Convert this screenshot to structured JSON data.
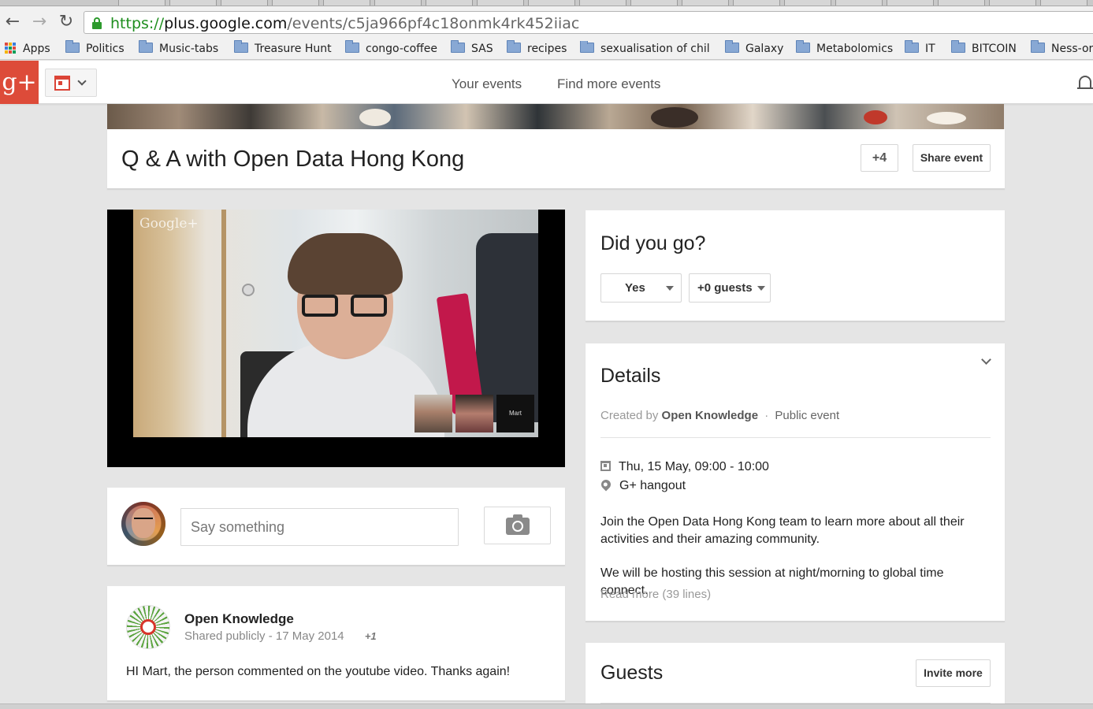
{
  "browser": {
    "url_scheme": "https://",
    "url_domain": "plus.google.com",
    "url_path": "/events/c5ja966pf4c18onmk4rk452iiac",
    "bookmarks": [
      {
        "label": "Apps"
      },
      {
        "label": "Politics"
      },
      {
        "label": "Music-tabs"
      },
      {
        "label": "Treasure Hunt"
      },
      {
        "label": "congo-coffee"
      },
      {
        "label": "SAS"
      },
      {
        "label": "recipes"
      },
      {
        "label": "sexualisation of chil"
      },
      {
        "label": "Galaxy"
      },
      {
        "label": "Metabolomics"
      },
      {
        "label": "IT"
      },
      {
        "label": "BITCOIN"
      },
      {
        "label": "Ness-or"
      }
    ]
  },
  "header": {
    "logo_text": "g+",
    "nav": [
      {
        "label": "Your events"
      },
      {
        "label": "Find more events"
      }
    ]
  },
  "event": {
    "title": "Q & A with Open Data Hong Kong",
    "plus_count": "+4",
    "share_label": "Share event"
  },
  "video": {
    "watermark": "Google+",
    "thumb_label": "Mart"
  },
  "comment": {
    "placeholder": "Say something"
  },
  "post": {
    "author": "Open Knowledge",
    "visibility": "Shared publicly",
    "separator": "-",
    "date": "17 May 2014",
    "plusone": "+1",
    "body": "HI Mart, the person commented on the youtube video. Thanks again!"
  },
  "rsvp": {
    "title": "Did you go?",
    "answer": "Yes",
    "guests": "+0 guests"
  },
  "details": {
    "title": "Details",
    "created_prefix": "Created by",
    "creator": "Open Knowledge",
    "dot": "·",
    "privacy": "Public event",
    "datetime": "Thu, 15 May, 09:00 - 10:00",
    "location": "G+ hangout",
    "description_1": "Join the Open Data Hong Kong team to learn more about all their activities and their amazing community.",
    "description_2": "We will be hosting this session at night/morning to global time connect.",
    "read_more": "Read more (39 lines)"
  },
  "guests": {
    "title": "Guests",
    "invite_label": "Invite more"
  },
  "colors": {
    "gplus_red": "#dd4b39",
    "url_green": "#1e8e1e",
    "page_bg": "#e5e5e5"
  }
}
